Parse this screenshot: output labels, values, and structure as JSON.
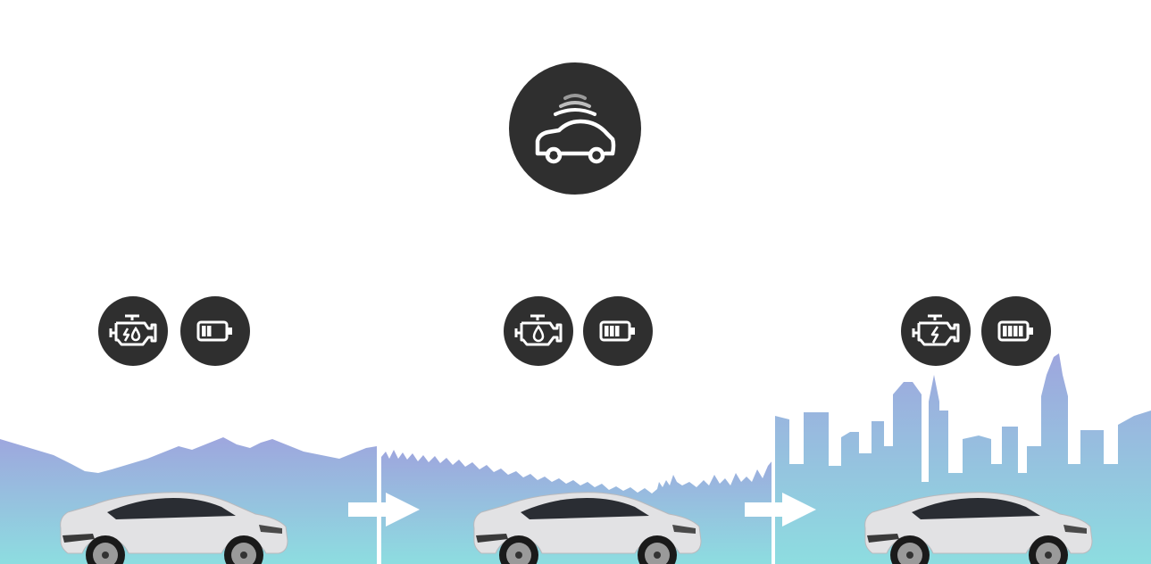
{
  "colors": {
    "circle_fill": "#2f2f2f",
    "icon_stroke": "#ffffff",
    "signal_light": "#9a9a9a",
    "sky_top": "#9ea6de",
    "sky_bottom": "#8ddde0",
    "divider": "#ffffff",
    "arrow": "#ffffff",
    "car_body": "#e2e2e4",
    "car_glass": "#2a2d33",
    "tire": "#1a1a1a",
    "rim": "#9a9a9a"
  },
  "top_icon": {
    "icon": "connected-car-icon"
  },
  "scenes": [
    {
      "id": "mountain",
      "landscape": "mountains",
      "engine_icon": "engine-electric-fuel-icon",
      "engine_symbol": "bolt-and-drop",
      "battery_icon": "battery-icon",
      "battery_level": 0.5
    },
    {
      "id": "suburb",
      "landscape": "forest-and-low-buildings",
      "engine_icon": "engine-fuel-icon",
      "engine_symbol": "drop",
      "battery_icon": "battery-icon",
      "battery_level": 0.75
    },
    {
      "id": "city",
      "landscape": "city-skyline",
      "engine_icon": "engine-electric-icon",
      "engine_symbol": "bolt",
      "battery_icon": "battery-icon",
      "battery_level": 1.0
    }
  ],
  "transitions": [
    {
      "from": "mountain",
      "to": "suburb",
      "icon": "arrow-right-icon"
    },
    {
      "from": "suburb",
      "to": "city",
      "icon": "arrow-right-icon"
    }
  ]
}
